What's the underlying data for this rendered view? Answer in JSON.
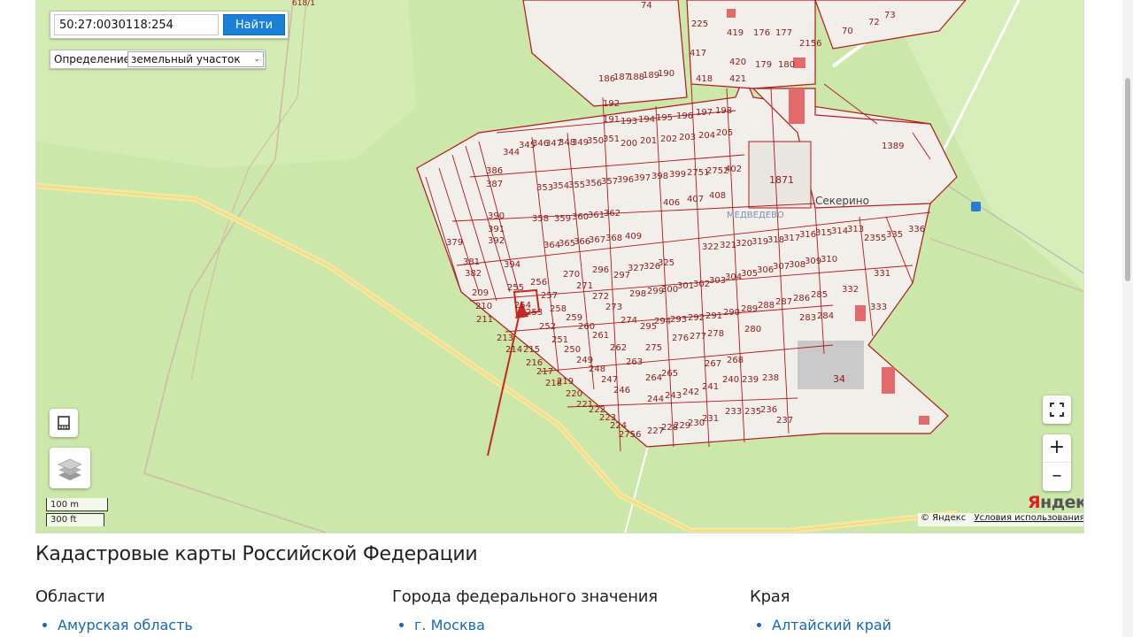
{
  "search": {
    "value": "50:27:0030118:254",
    "button_label": "Найти"
  },
  "definition": {
    "label": "Определение:",
    "selected": "земельный участок"
  },
  "map": {
    "background_color": "#cbe7a9",
    "plot_fill": "#f2efea",
    "plot_border": "#b3171b",
    "place_labels": {
      "sekerino": "Секерино",
      "medvedevo": "МЕДВЕДЕВО"
    },
    "highway_label": "618/1",
    "plot_numbers": {
      "p74": "74",
      "p225": "225",
      "p419": "419",
      "p176": "176",
      "p177": "177",
      "p2156": "2156",
      "p417": "417",
      "p420": "420",
      "p179": "179",
      "p180": "180",
      "p418": "418",
      "p421": "421",
      "p186": "186",
      "p187": "187",
      "p188": "188",
      "p189": "189",
      "p190": "190",
      "p191": "191",
      "p192": "192",
      "p193": "193",
      "p194": "194",
      "p195": "195",
      "p196": "196",
      "p197": "197",
      "p198": "198",
      "p200": "200",
      "p201": "201",
      "p202": "202",
      "p203": "203",
      "p204": "204",
      "p205": "205",
      "p1389": "1389",
      "p1871": "1871",
      "p345": "345",
      "p346": "346",
      "p347": "347",
      "p348": "348",
      "p349": "349",
      "p350": "350",
      "p351": "351",
      "p344": "344",
      "p386": "386",
      "p387": "387",
      "p353": "353",
      "p354": "354",
      "p355": "355",
      "p356": "356",
      "p357": "357",
      "p396": "396",
      "p397": "397",
      "p398": "398",
      "p399": "399",
      "p2751": "2751",
      "p2752": "2752",
      "p402": "402",
      "p390": "390",
      "p391": "391",
      "p392": "392",
      "p358": "358",
      "p359": "359",
      "p360": "360",
      "p361": "361",
      "p362": "362",
      "p406": "406",
      "p407": "407",
      "p408": "408",
      "p379": "379",
      "p381": "381",
      "p382": "382",
      "p394": "394",
      "p364": "364",
      "p365": "365",
      "p366": "366",
      "p367": "367",
      "p368": "368",
      "p409": "409",
      "p322": "322",
      "p321": "321",
      "p320": "320",
      "p319": "319",
      "p318": "318",
      "p317": "317",
      "p316": "316",
      "p315": "315",
      "p314": "314",
      "p313": "313",
      "p2355": "2355",
      "p335": "335",
      "p336": "336",
      "p209": "209",
      "p210": "210",
      "p211": "211",
      "p255": "255",
      "p256": "256",
      "p257": "257",
      "p254": "254",
      "p253": "253",
      "p270": "270",
      "p271": "271",
      "p296": "296",
      "p297": "297",
      "p327": "327",
      "p326": "326",
      "p325": "325",
      "p300": "300",
      "p301": "301",
      "p302": "302",
      "p303": "303",
      "p304": "304",
      "p305": "305",
      "p306": "306",
      "p307": "307",
      "p308": "308",
      "p309": "309",
      "p310": "310",
      "p331": "331",
      "p332": "332",
      "p333": "333",
      "p298": "298",
      "p299": "299",
      "p294": "294",
      "p293": "293",
      "p292": "292",
      "p291": "291",
      "p290": "290",
      "p289": "289",
      "p288": "288",
      "p287": "287",
      "p286": "286",
      "p285": "285",
      "p284": "284",
      "p283": "283",
      "p258": "258",
      "p259": "259",
      "p260": "260",
      "p261": "261",
      "p272": "272",
      "p273": "273",
      "p274": "274",
      "p295": "295",
      "p276": "276",
      "p277": "277",
      "p278": "278",
      "p280": "280",
      "p213": "213",
      "p214": "214",
      "p215": "215",
      "p216": "216",
      "p217": "217",
      "p218": "218",
      "p219": "219",
      "p220": "220",
      "p221": "221",
      "p222": "222",
      "p223": "223",
      "p224": "224",
      "p251": "251",
      "p252": "252",
      "p250": "250",
      "p249": "249",
      "p248": "248",
      "p247": "247",
      "p246": "246",
      "p262": "262",
      "p263": "263",
      "p275": "275",
      "p264": "264",
      "p265": "265",
      "p241": "241",
      "p242": "242",
      "p243": "243",
      "p244": "244",
      "p267": "267",
      "p268": "268",
      "p240": "240",
      "p239": "239",
      "p238": "238",
      "p2756": "2756",
      "p227": "227",
      "p228": "228",
      "p229": "229",
      "p230": "230",
      "p231": "231",
      "p233": "233",
      "p235": "235",
      "p236": "236",
      "p237": "237",
      "p34": "34",
      "p70": "70",
      "p72": "72",
      "p73": "73"
    }
  },
  "scale": {
    "metric": "100 m",
    "imperial": "300 ft"
  },
  "attribution": {
    "logo_first": "Я",
    "logo_rest": "ндекс",
    "copyright": "© Яндекс",
    "terms": "Условия использования"
  },
  "controls": {
    "zoom_in": "+",
    "zoom_out": "–"
  },
  "content": {
    "heading": "Кадастровые карты Российской Федерации",
    "columns": [
      {
        "title": "Области",
        "items": [
          "Амурская область"
        ]
      },
      {
        "title": "Города федерального значения",
        "items": [
          "г. Москва"
        ]
      },
      {
        "title": "Края",
        "items": [
          "Алтайский край"
        ]
      }
    ]
  }
}
